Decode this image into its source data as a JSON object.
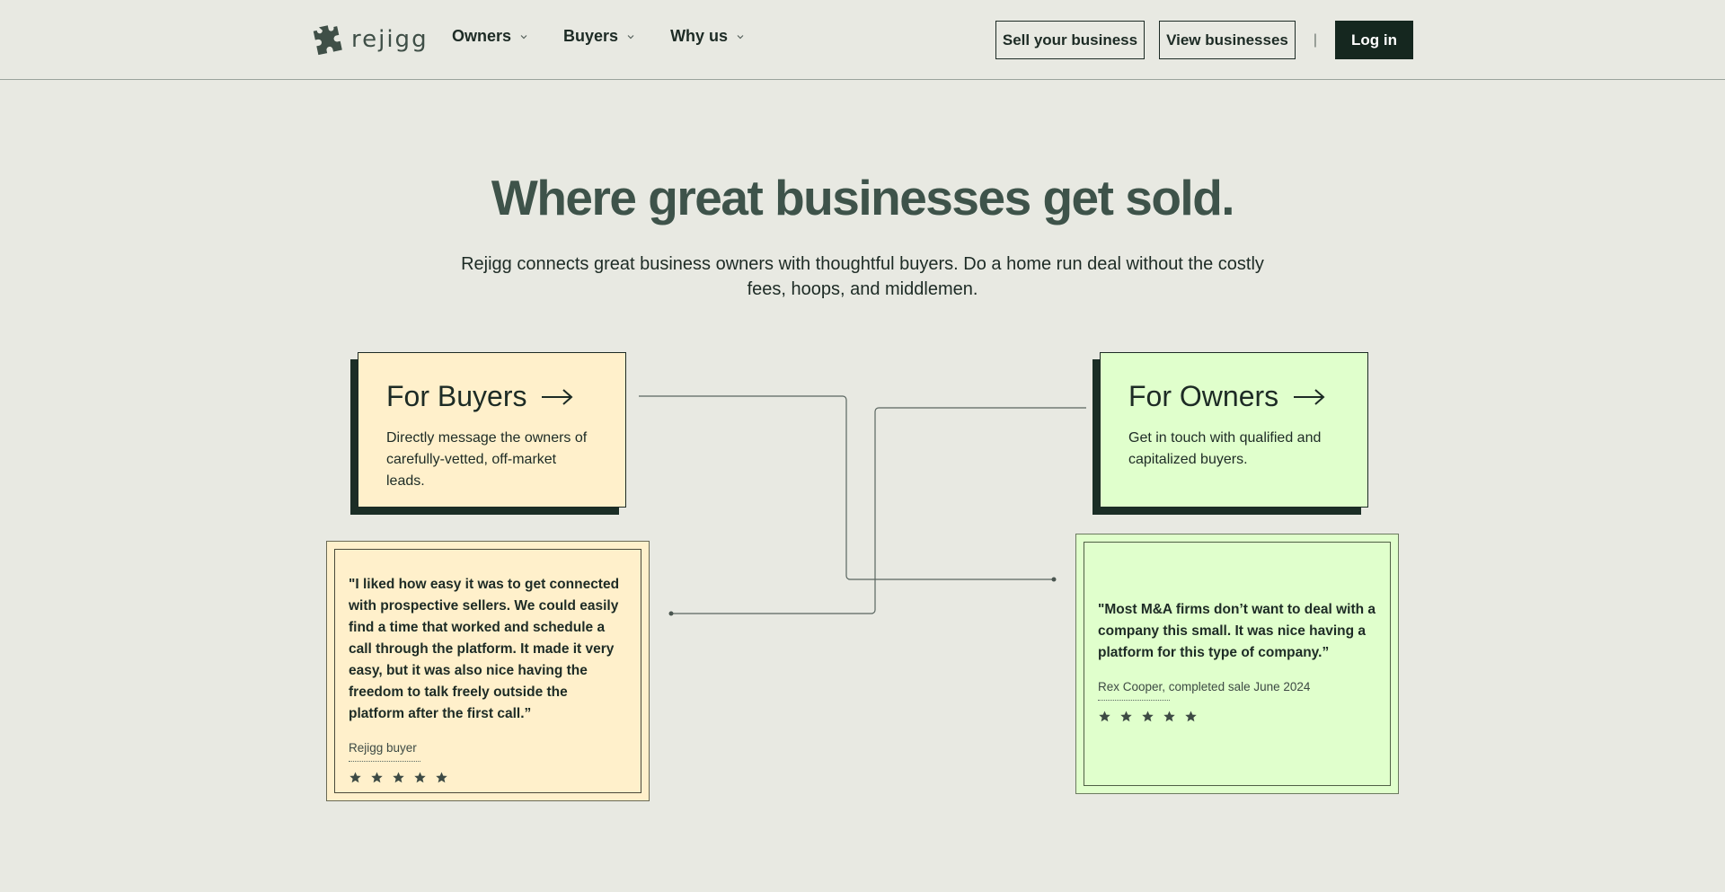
{
  "header": {
    "logo_text": "rejigg",
    "nav": [
      {
        "label": "Owners"
      },
      {
        "label": "Buyers"
      },
      {
        "label": "Why us"
      }
    ],
    "sell_label": "Sell your business",
    "view_label": "View businesses",
    "separator": "|",
    "login_label": "Log in"
  },
  "hero": {
    "title": "Where great businesses get sold.",
    "subtitle": "Rejigg connects great business owners with thoughtful buyers. Do a home run deal without the costly fees, hoops, and middlemen."
  },
  "cards": {
    "buyers": {
      "title": "For Buyers",
      "description": "Directly message the owners of carefully-vetted, off-market leads."
    },
    "owners": {
      "title": "For Owners",
      "description": "Get in touch with qualified and capitalized buyers."
    }
  },
  "testimonials": {
    "buyer": {
      "quote": "\"I liked how easy it was to get connected with prospective sellers. We could easily find a time that worked and schedule a call through the platform. It made it very easy, but it was also nice having the freedom to talk freely outside the platform after the first call.”",
      "author": "Rejigg buyer",
      "rating": 5
    },
    "owner": {
      "quote": "\"Most M&A firms don’t want to deal with a company this small. It was nice having a platform for this type of company.”",
      "author": "Rex Cooper, completed sale June 2024",
      "rating": 5
    }
  },
  "colors": {
    "background": "#e8e9e2",
    "dark": "#15271f",
    "buyers_card": "#fff0cb",
    "owners_card": "#e0ffcc",
    "hero_title": "#3e534a"
  }
}
